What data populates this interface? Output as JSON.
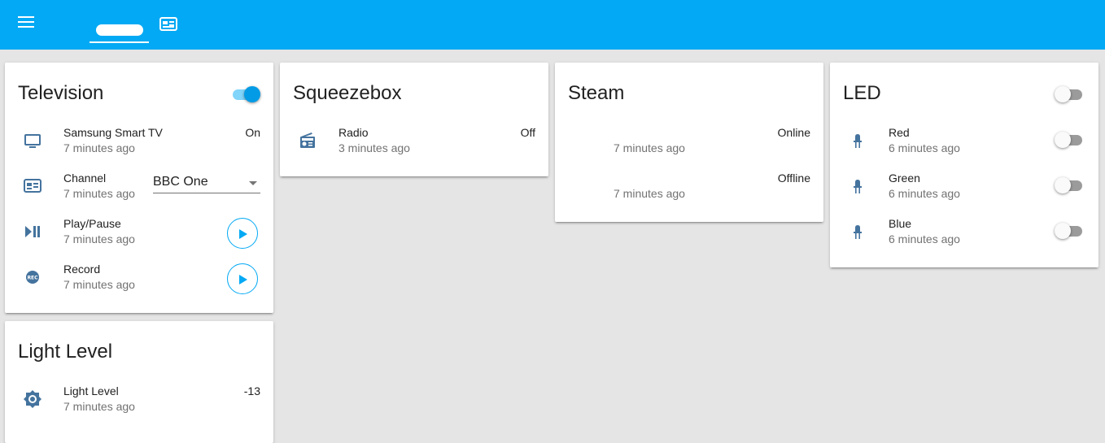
{
  "header": {
    "icons": {
      "menu": "menu-icon",
      "tv_tab": "television-guide-icon"
    },
    "accent": "#03a9f4"
  },
  "cards": {
    "television": {
      "title": "Television",
      "toggle_on": true,
      "rows": [
        {
          "name": "Samsung Smart TV",
          "time": "7 minutes ago",
          "state": "On",
          "icon": "television-icon"
        },
        {
          "name": "Channel",
          "time": "7 minutes ago",
          "select_value": "BBC One",
          "icon": "television-guide-icon"
        },
        {
          "name": "Play/Pause",
          "time": "7 minutes ago",
          "icon": "play-pause-icon"
        },
        {
          "name": "Record",
          "time": "7 minutes ago",
          "icon": "record-rec-icon"
        }
      ]
    },
    "light_level": {
      "title": "Light Level",
      "rows": [
        {
          "name": "Light Level",
          "time": "7 minutes ago",
          "state": "-13",
          "icon": "brightness-icon"
        }
      ]
    },
    "squeezebox": {
      "title": "Squeezebox",
      "rows": [
        {
          "name": "Radio",
          "time": "3 minutes ago",
          "state": "Off",
          "icon": "radio-icon"
        }
      ]
    },
    "steam": {
      "title": "Steam",
      "rows": [
        {
          "time": "7 minutes ago",
          "state": "Online"
        },
        {
          "time": "7 minutes ago",
          "state": "Offline"
        }
      ]
    },
    "led": {
      "title": "LED",
      "toggle_on": false,
      "rows": [
        {
          "name": "Red",
          "time": "6 minutes ago",
          "toggle_on": false,
          "icon": "led-icon"
        },
        {
          "name": "Green",
          "time": "6 minutes ago",
          "toggle_on": false,
          "icon": "led-icon"
        },
        {
          "name": "Blue",
          "time": "6 minutes ago",
          "toggle_on": false,
          "icon": "led-icon"
        }
      ]
    }
  },
  "colors": {
    "icon": "#44739e",
    "toggle_active": "#039be5",
    "secondary_text": "#727272"
  }
}
